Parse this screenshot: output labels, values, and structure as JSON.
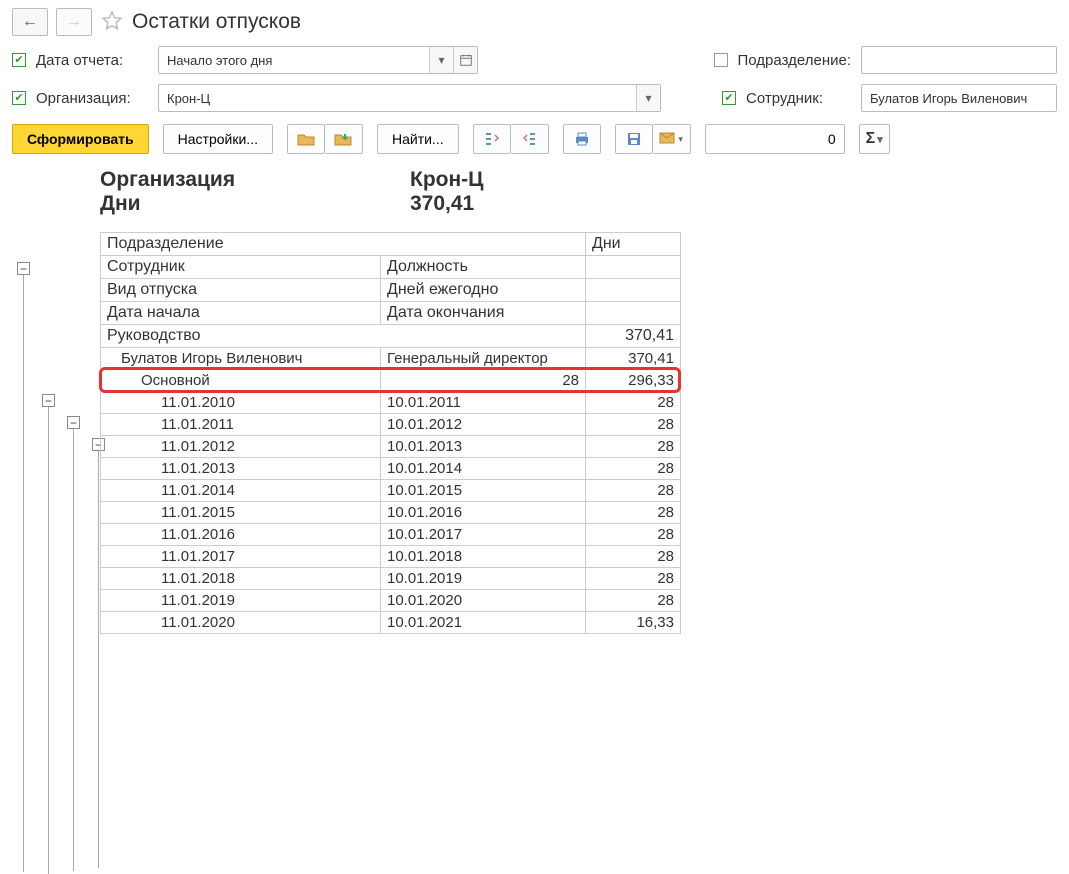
{
  "title": "Остатки отпусков",
  "nav": {
    "back": "←",
    "forward": "→"
  },
  "filters": {
    "date_label": "Дата отчета:",
    "date_value": "Начало этого дня",
    "org_label": "Организация:",
    "org_value": "Крон-Ц",
    "dept_label": "Подразделение:",
    "dept_value": "",
    "emp_label": "Сотрудник:",
    "emp_value": "Булатов Игорь Виленович"
  },
  "toolbar": {
    "generate": "Сформировать",
    "settings": "Настройки...",
    "find": "Найти...",
    "number_value": "0",
    "sigma": "Σ"
  },
  "summary": {
    "org_label": "Организация",
    "org_value": "Крон-Ц",
    "days_label": "Дни",
    "days_value": "370,41"
  },
  "table": {
    "headers": {
      "dept": "Подразделение",
      "days": "Дни",
      "employee": "Сотрудник",
      "position": "Должность",
      "vac_type": "Вид отпуска",
      "days_per_year": "Дней ежегодно",
      "start": "Дата начала",
      "end": "Дата окончания"
    },
    "group1": {
      "name": "Руководство",
      "days": "370,41"
    },
    "emp_row": {
      "name": "Булатов Игорь Виленович",
      "position": "Генеральный директор",
      "days": "370,41"
    },
    "vac_row": {
      "type": "Основной",
      "per_year": "28",
      "days": "296,33"
    },
    "periods": [
      {
        "start": "11.01.2010",
        "end": "10.01.2011",
        "days": "28"
      },
      {
        "start": "11.01.2011",
        "end": "10.01.2012",
        "days": "28"
      },
      {
        "start": "11.01.2012",
        "end": "10.01.2013",
        "days": "28"
      },
      {
        "start": "11.01.2013",
        "end": "10.01.2014",
        "days": "28"
      },
      {
        "start": "11.01.2014",
        "end": "10.01.2015",
        "days": "28"
      },
      {
        "start": "11.01.2015",
        "end": "10.01.2016",
        "days": "28"
      },
      {
        "start": "11.01.2016",
        "end": "10.01.2017",
        "days": "28"
      },
      {
        "start": "11.01.2017",
        "end": "10.01.2018",
        "days": "28"
      },
      {
        "start": "11.01.2018",
        "end": "10.01.2019",
        "days": "28"
      },
      {
        "start": "11.01.2019",
        "end": "10.01.2020",
        "days": "28"
      },
      {
        "start": "11.01.2020",
        "end": "10.01.2021",
        "days": "16,33"
      }
    ]
  }
}
